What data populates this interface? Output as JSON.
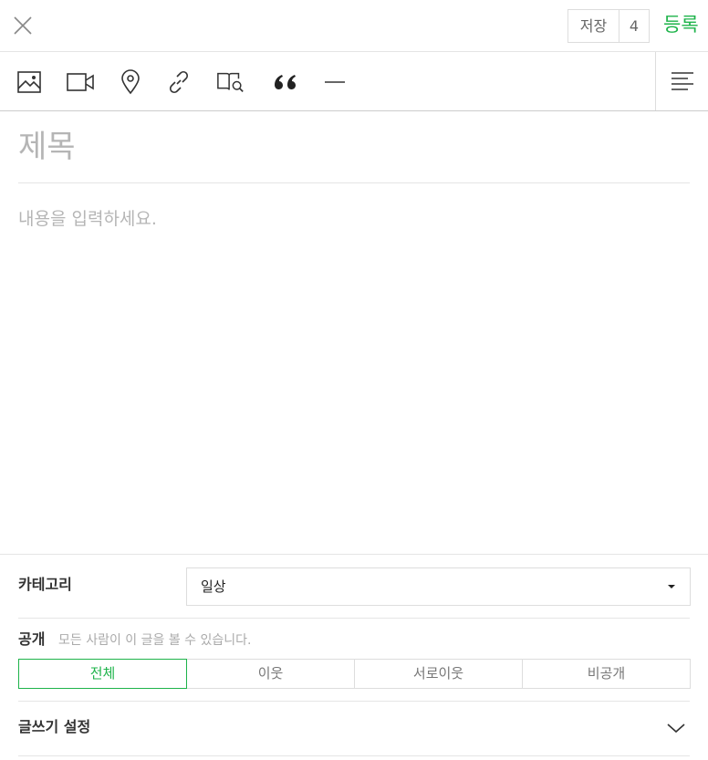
{
  "header": {
    "close_icon": "close-icon",
    "save_label": "저장",
    "save_count": "4",
    "publish_label": "등록",
    "accent_color": "#1db34a"
  },
  "toolbar": {
    "tools": [
      "image-icon",
      "video-icon",
      "location-pin-icon",
      "link-icon",
      "book-search-icon",
      "quote-icon",
      "horizontal-line-icon"
    ],
    "align_icon": "align-left-icon"
  },
  "editor": {
    "title_placeholder": "제목",
    "body_placeholder": "내용을 입력하세요."
  },
  "settings": {
    "category_label": "카테고리",
    "category_value": "일상",
    "visibility_label": "공개",
    "visibility_desc": "모든 사람이 이 글을 볼 수 있습니다.",
    "visibility_options": [
      "전체",
      "이웃",
      "서로이웃",
      "비공개"
    ],
    "visibility_selected": "전체",
    "write_settings_label": "글쓰기 설정"
  }
}
